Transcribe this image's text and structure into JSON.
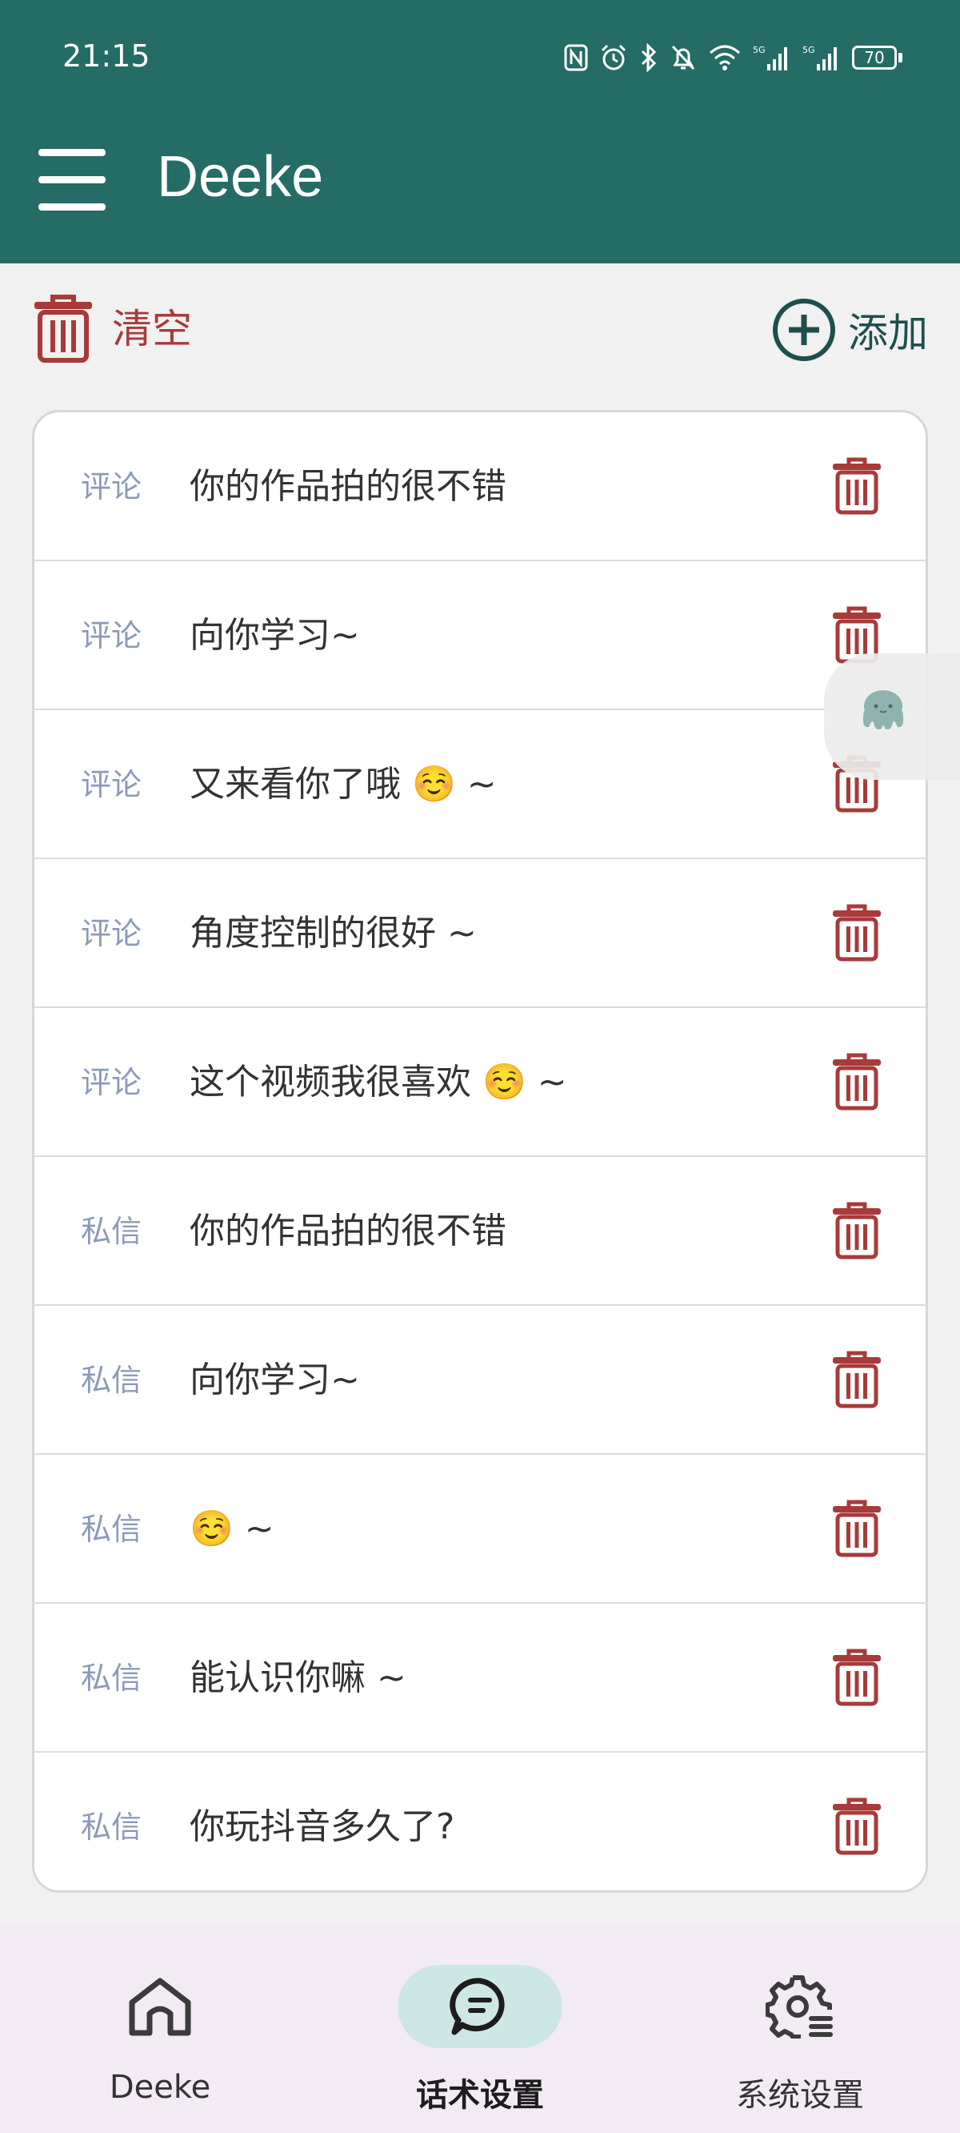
{
  "status_bar": {
    "time": "21:15",
    "battery": "70"
  },
  "app_bar": {
    "title": "Deeke"
  },
  "toolbar": {
    "clear_label": "清空",
    "add_label": "添加"
  },
  "phrases": [
    {
      "type": "评论",
      "text": "你的作品拍的很不错"
    },
    {
      "type": "评论",
      "text": "向你学习~"
    },
    {
      "type": "评论",
      "text": "又来看你了哦 ☺️ ~"
    },
    {
      "type": "评论",
      "text": "角度控制的很好 ~"
    },
    {
      "type": "评论",
      "text": "这个视频我很喜欢 ☺️ ~"
    },
    {
      "type": "私信",
      "text": "你的作品拍的很不错"
    },
    {
      "type": "私信",
      "text": "向你学习~"
    },
    {
      "type": "私信",
      "text": "☺️ ~"
    },
    {
      "type": "私信",
      "text": "能认识你嘛 ~"
    },
    {
      "type": "私信",
      "text": "你玩抖音多久了?"
    }
  ],
  "bottom_nav": [
    {
      "label": "Deeke",
      "icon": "home-icon",
      "active": false
    },
    {
      "label": "话术设置",
      "icon": "chat-bubble-icon",
      "active": true
    },
    {
      "label": "系统设置",
      "icon": "settings-gear-icon",
      "active": false
    }
  ],
  "colors": {
    "primary": "#256b66",
    "delete": "#a83a3a",
    "tag_text": "#8c9ab8",
    "nav_background": "#f2ebf4",
    "nav_active_pill": "#cde7e4"
  }
}
